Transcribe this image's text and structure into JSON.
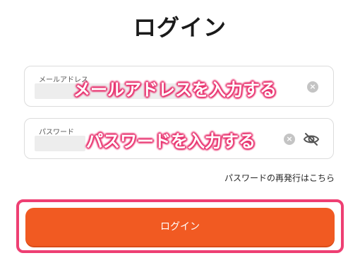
{
  "page": {
    "title": "ログイン"
  },
  "email": {
    "label": "メールアドレス",
    "annotation": "メールアドレスを入力する"
  },
  "password": {
    "label": "パスワード",
    "annotation": "パスワードを入力する"
  },
  "clear_glyph": "×",
  "reset_link": "パスワードの再発行はこちら",
  "login_button": "ログイン",
  "colors": {
    "accent": "#f15a22",
    "annotation": "#ee3f73"
  },
  "icons": [
    "clear-icon",
    "eye-slash-icon"
  ]
}
